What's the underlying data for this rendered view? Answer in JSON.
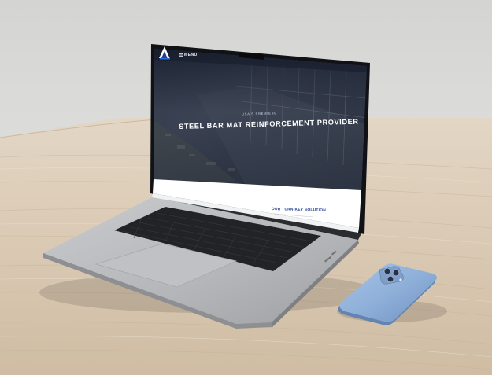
{
  "website": {
    "menu_label": "MENU",
    "hero_kicker": "USA'S PREMIERE",
    "hero_title": "STEEL BAR MAT REINFORCEMENT PROVIDER",
    "section_heading": "OUR TURN-KEY SOLUTION"
  },
  "colors": {
    "wall": "#d6d6d4",
    "desk": "#d9c9b4",
    "laptop_body": "#b9bbbe",
    "screen_overlay": "#1c2638",
    "brand_blue": "#24408e",
    "phone": "#8fb0d9"
  }
}
